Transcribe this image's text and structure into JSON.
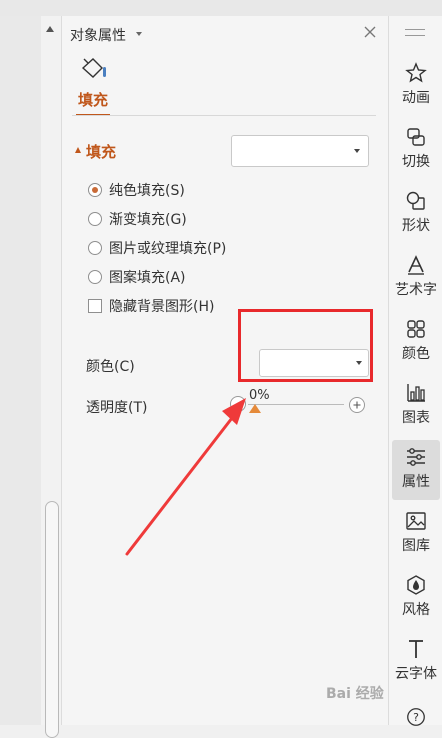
{
  "panel": {
    "title": "对象属性",
    "tab_label": "填充",
    "section_title": "填充",
    "fill_options": [
      {
        "label": "纯色填充(S)",
        "selected": true
      },
      {
        "label": "渐变填充(G)",
        "selected": false
      },
      {
        "label": "图片或纹理填充(P)",
        "selected": false
      },
      {
        "label": "图案填充(A)",
        "selected": false
      }
    ],
    "hide_background_label": "隐藏背景图形(H)",
    "color_label": "颜色(C)",
    "opacity_label": "透明度(T)",
    "opacity_value": "0%",
    "opacity_fraction": 0
  },
  "sidebar": {
    "items": [
      {
        "label": "动画",
        "icon": "star-icon"
      },
      {
        "label": "切换",
        "icon": "transition-icon"
      },
      {
        "label": "形状",
        "icon": "shape-icon"
      },
      {
        "label": "艺术字",
        "icon": "wordart-icon"
      },
      {
        "label": "颜色",
        "icon": "color-grid-icon"
      },
      {
        "label": "图表",
        "icon": "chart-icon"
      },
      {
        "label": "属性",
        "icon": "sliders-icon",
        "active": true
      },
      {
        "label": "图库",
        "icon": "image-icon"
      },
      {
        "label": "风格",
        "icon": "style-icon"
      },
      {
        "label": "云字体",
        "icon": "font-icon"
      }
    ]
  },
  "colors": {
    "accent": "#c0571b",
    "highlight_box": "#e8292c",
    "slider_thumb": "#e58a3a"
  },
  "watermark": "Bai 经验"
}
